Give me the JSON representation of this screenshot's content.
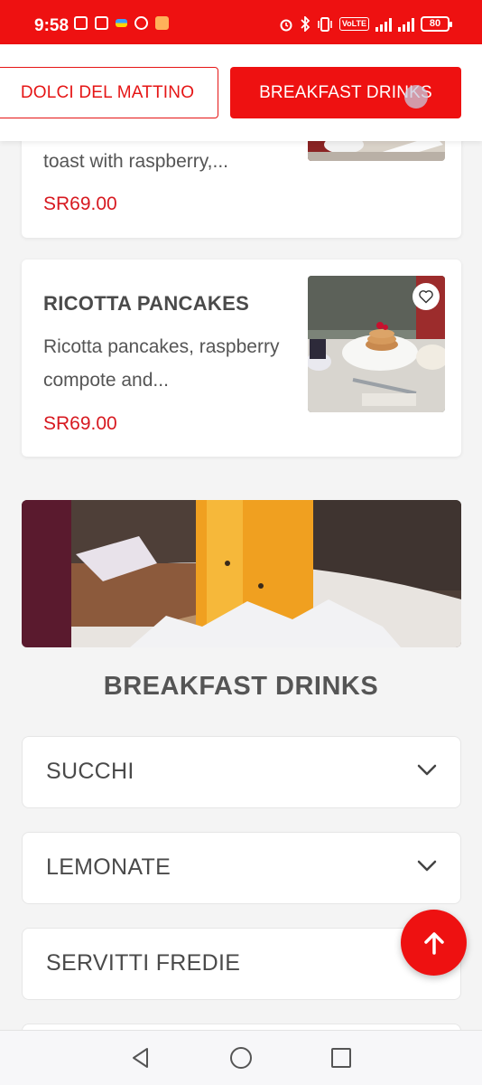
{
  "status_bar": {
    "time": "9:58",
    "battery": "80",
    "background_color": "#ee1111",
    "left_icons": [
      "nfc-icon",
      "app-notification-icon",
      "flag-icon",
      "browser-icon",
      "shopping-icon"
    ],
    "right_icons": [
      "alarm-icon",
      "bluetooth-icon",
      "vibrate-icon",
      "volte-icon",
      "signal-icon",
      "wifi-signal-icon",
      "battery-icon"
    ],
    "volte_label": "VoLTE"
  },
  "category_tabs": [
    {
      "label": "DOLCI DEL MATTINO",
      "active": false
    },
    {
      "label": "BREAKFAST DRINKS",
      "active": true
    }
  ],
  "menu_items": [
    {
      "title": "",
      "description": "toast with raspberry,...",
      "price": "SR69.00"
    },
    {
      "title": "RICOTTA PANCAKES",
      "description": "Ricotta pancakes, raspberry compote and...",
      "price": "SR69.00",
      "image": "ricotta-pancakes-photo",
      "favorite_icon": "heart-outline-icon"
    }
  ],
  "section": {
    "banner_image": "breakfast-drinks-banner-photo",
    "title": "BREAKFAST DRINKS",
    "subcategories": [
      {
        "label": "SUCCHI",
        "icon": "chevron-down-icon"
      },
      {
        "label": "LEMONATE",
        "icon": "chevron-down-icon"
      },
      {
        "label": "SERVITTI FREDIE",
        "icon": "chevron-down-icon"
      },
      {
        "label": "",
        "icon": ""
      }
    ]
  },
  "scroll_top_button": {
    "icon": "arrow-up-icon"
  },
  "navigation_bar": {
    "buttons": [
      "back-icon",
      "home-icon",
      "recents-icon"
    ]
  },
  "colors": {
    "accent": "#ee1111",
    "price": "#d71920",
    "text": "#4a4a4a",
    "background": "#f4f4f4"
  }
}
